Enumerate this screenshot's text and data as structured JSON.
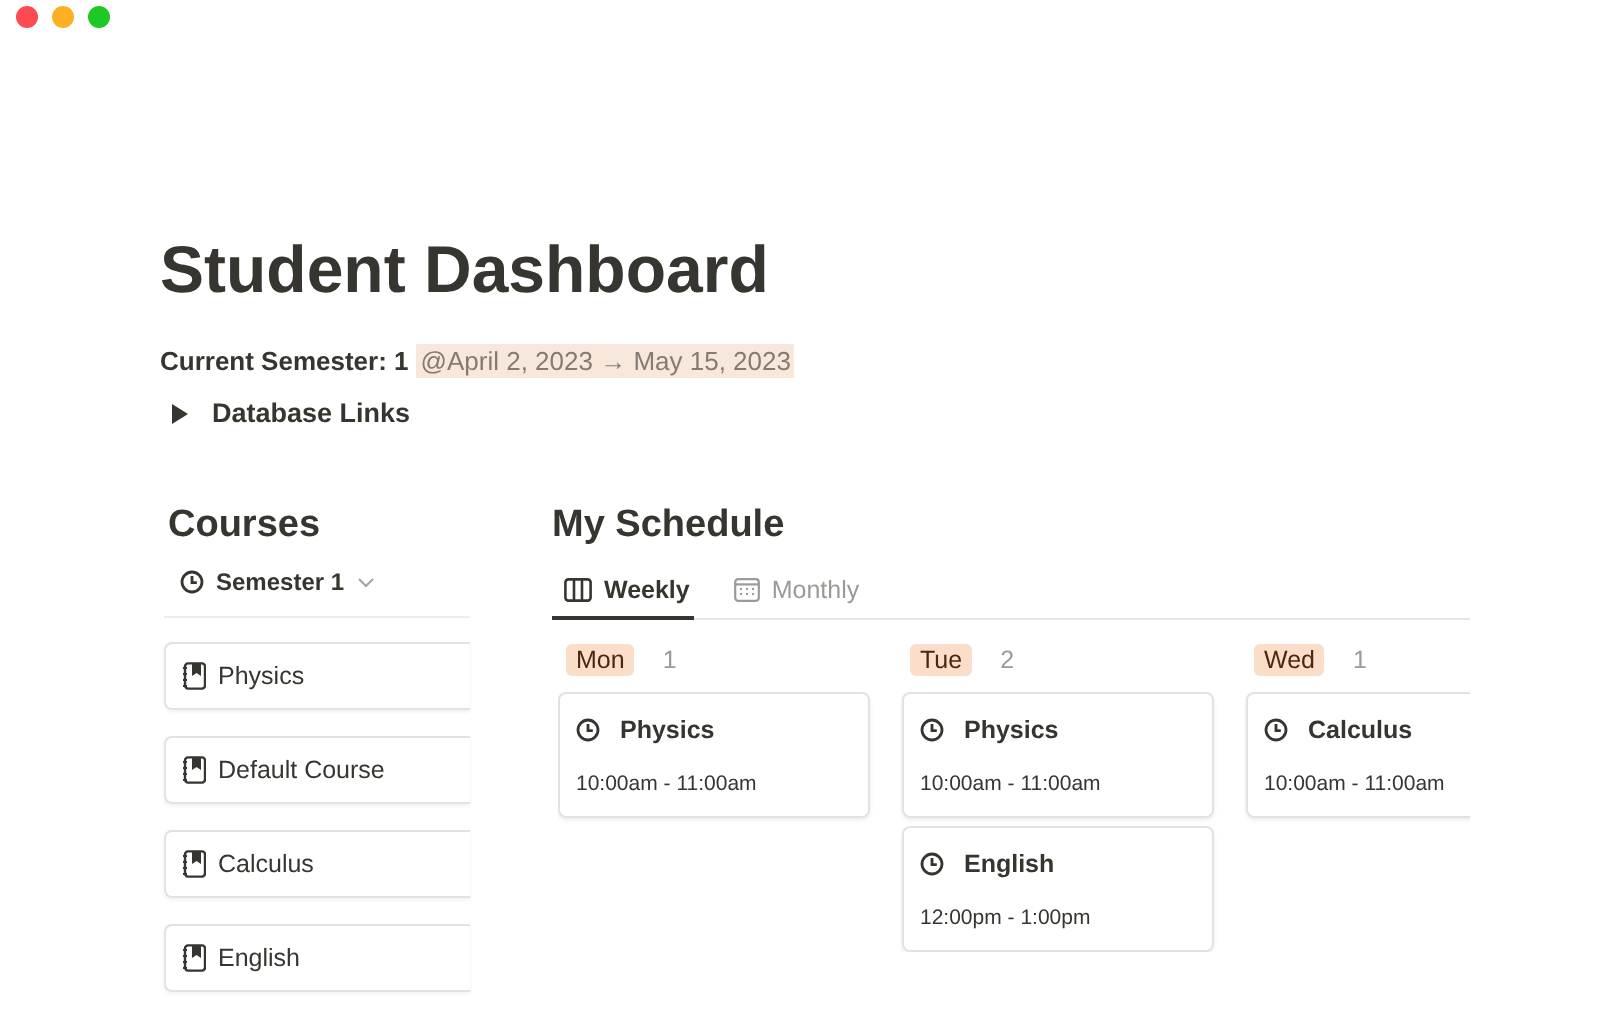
{
  "title": "Student Dashboard",
  "semester": {
    "label": "Current Semester: 1",
    "date_range": "@April 2, 2023 → May 15, 2023"
  },
  "toggle": {
    "label": "Database Links",
    "expanded": false
  },
  "courses": {
    "heading": "Courses",
    "filter": "Semester 1",
    "items": [
      {
        "name": "Physics"
      },
      {
        "name": "Default Course"
      },
      {
        "name": "Calculus"
      },
      {
        "name": "English"
      }
    ]
  },
  "schedule": {
    "heading": "My Schedule",
    "tabs": [
      {
        "label": "Weekly",
        "kind": "board",
        "selected": true
      },
      {
        "label": "Monthly",
        "kind": "calendar",
        "selected": false
      }
    ],
    "columns": [
      {
        "day": "Mon",
        "count": "1",
        "events": [
          {
            "name": "Physics",
            "time": "10:00am - 11:00am"
          }
        ]
      },
      {
        "day": "Tue",
        "count": "2",
        "events": [
          {
            "name": "Physics",
            "time": "10:00am - 11:00am"
          },
          {
            "name": "English",
            "time": "12:00pm - 1:00pm"
          }
        ]
      },
      {
        "day": "Wed",
        "count": "1",
        "events": [
          {
            "name": "Calculus",
            "time": "10:00am - 11:00am"
          }
        ]
      }
    ]
  }
}
